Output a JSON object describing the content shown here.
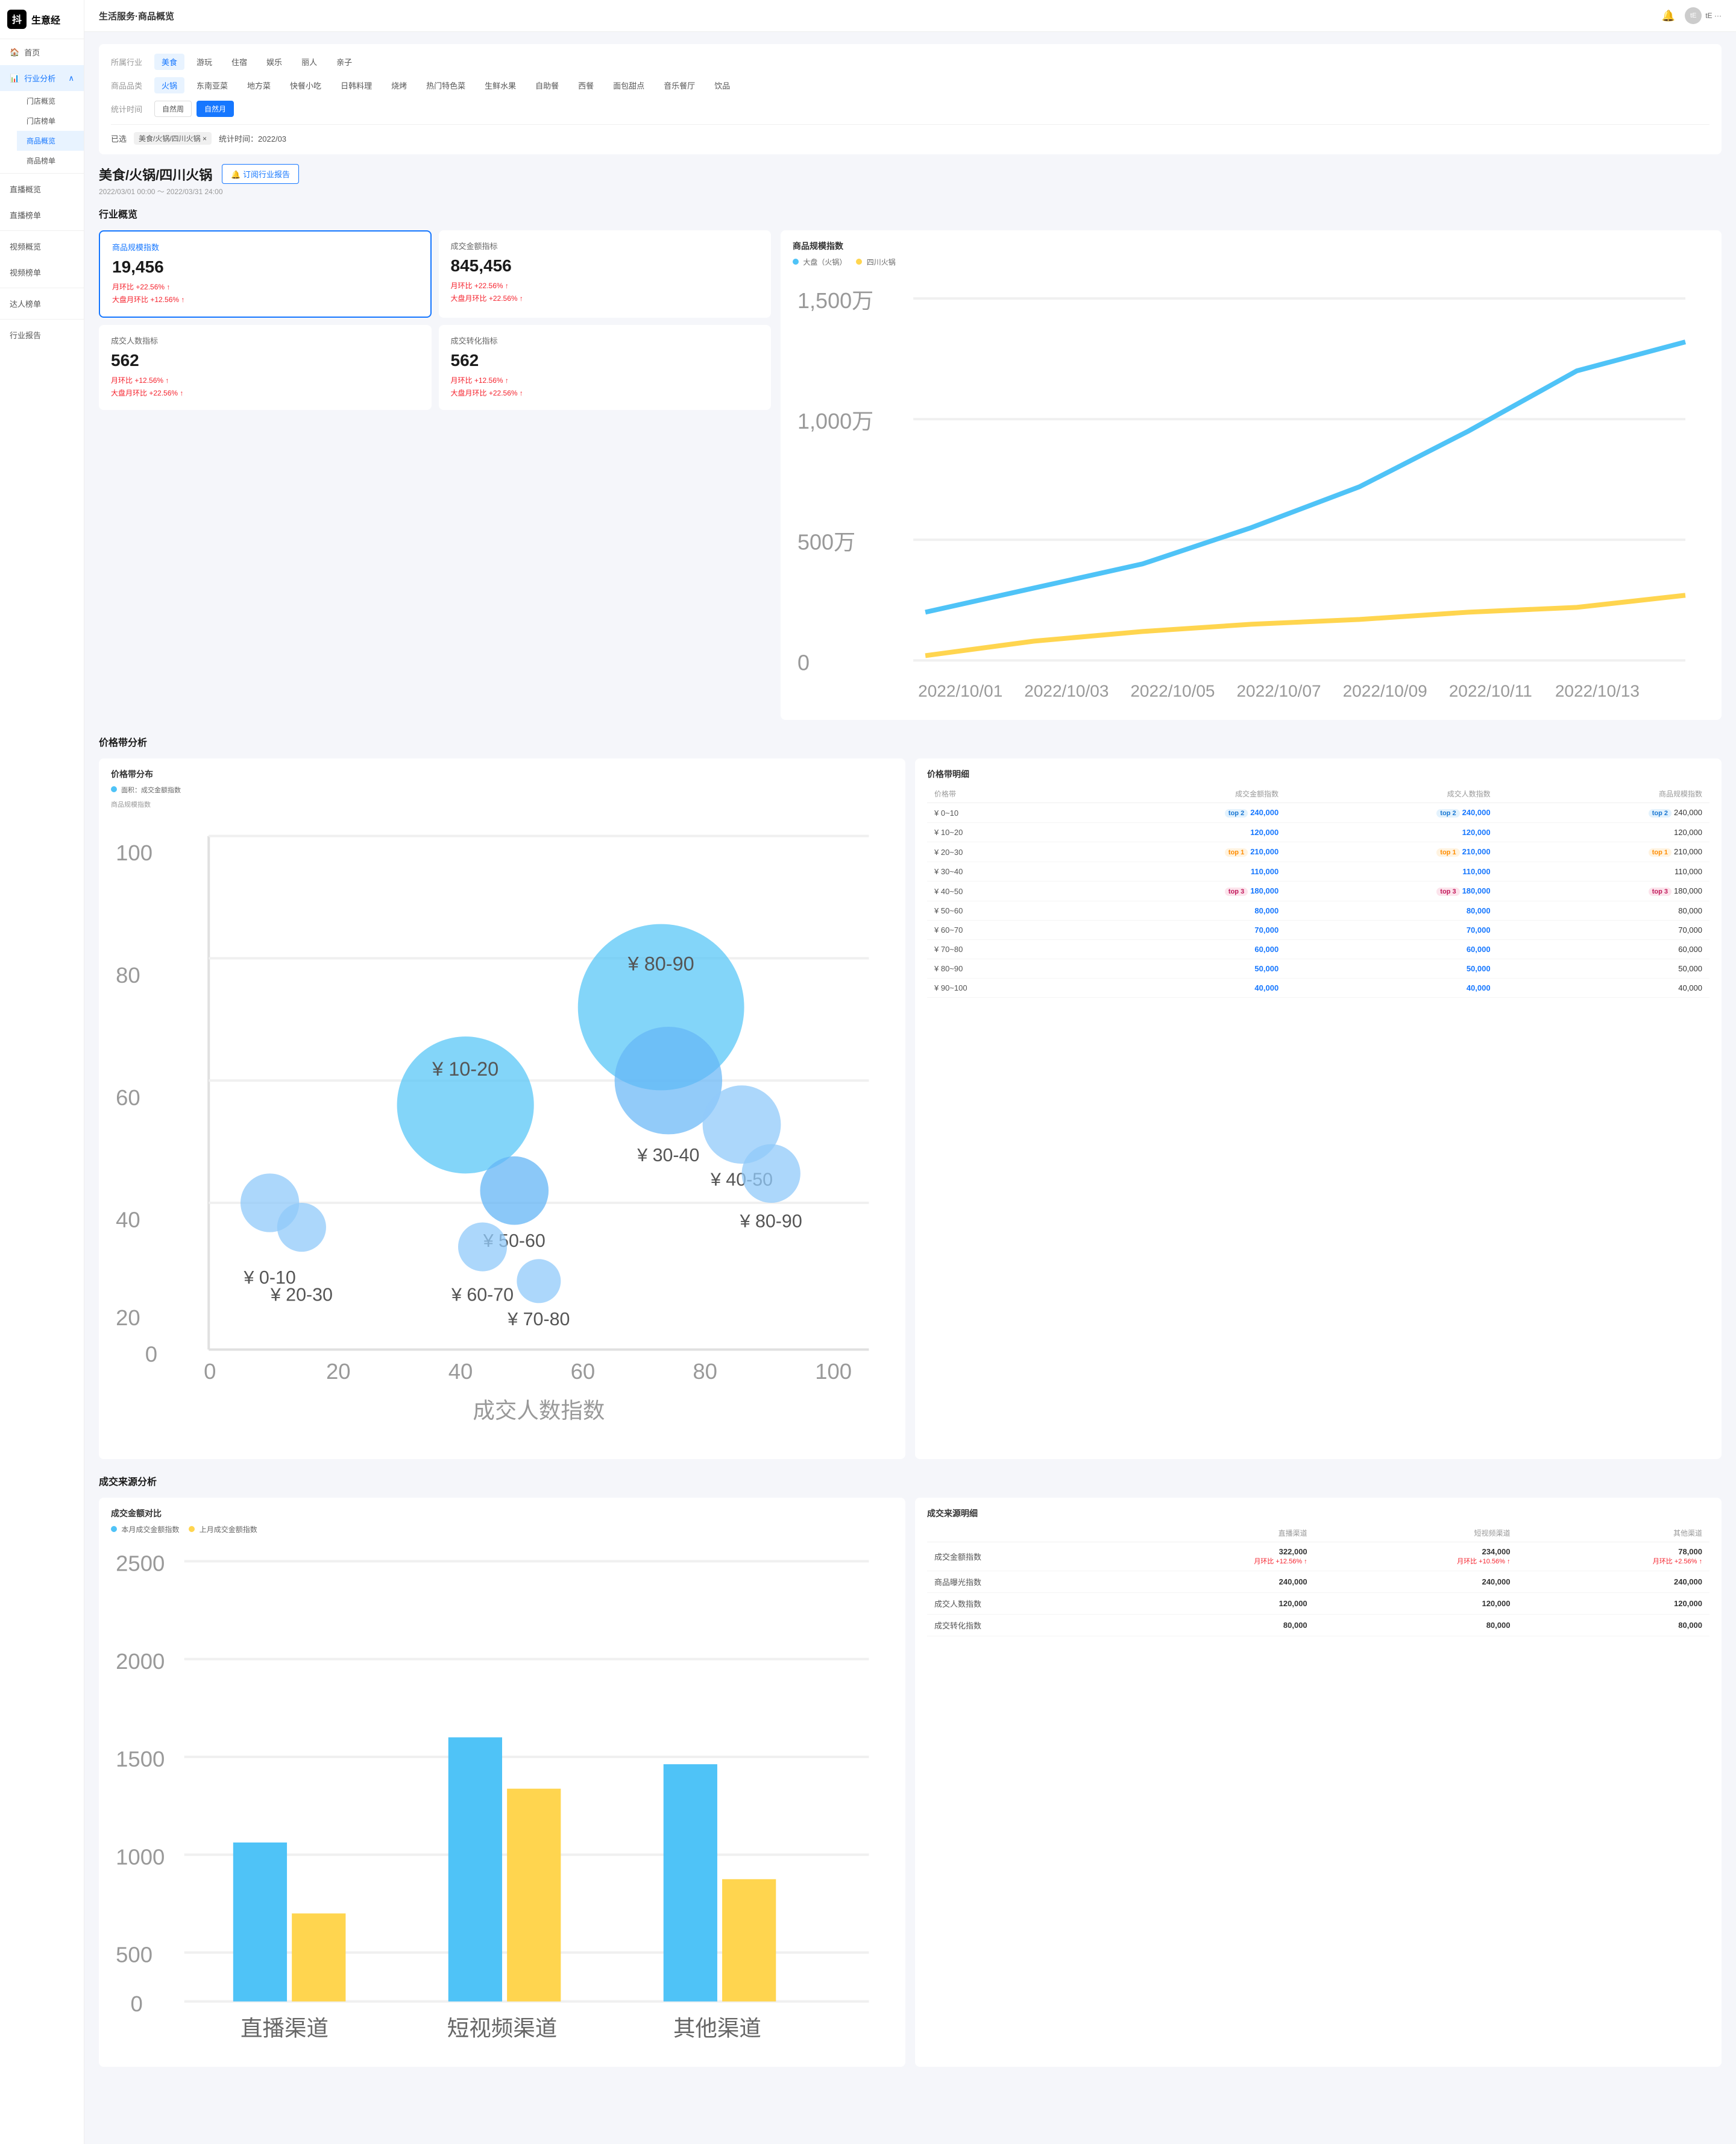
{
  "app": {
    "logo_text": "生意经",
    "topbar_title": "生活服务·商品概览",
    "bell_label": "🔔",
    "user_label": "tE ···"
  },
  "sidebar": {
    "home": "首页",
    "industry": "行业分析",
    "store_overview": "门店概览",
    "store_rank": "门店榜单",
    "product_overview": "商品概览",
    "product_rank": "商品榜单",
    "live_overview": "直播概览",
    "live_rank": "直播榜单",
    "video_overview": "视频概览",
    "video_rank": "视频榜单",
    "kol_rank": "达人榜单",
    "report": "行业报告"
  },
  "filters": {
    "industry_label": "所属行业",
    "product_label": "商品品类",
    "time_label": "统计时间",
    "industry_tags": [
      "美食",
      "游玩",
      "住宿",
      "娱乐",
      "丽人",
      "亲子"
    ],
    "product_tags": [
      "火锅",
      "东南亚菜",
      "地方菜",
      "快餐小吃",
      "日韩料理",
      "烧烤",
      "热门特色菜",
      "生鲜水果",
      "自助餐",
      "西餐",
      "面包甜点",
      "音乐餐厅",
      "饮品"
    ],
    "time_tags": [
      "自然周",
      "自然月"
    ],
    "active_industry": "美食",
    "active_product": "火锅",
    "active_time": "自然月",
    "selected": "美食/火锅/四川火锅 ×",
    "stat_time": "统计时间：2022/03"
  },
  "page": {
    "title": "美食/火锅/四川火锅",
    "subscribe_btn": "🔔 订阅行业报告",
    "date_range": "2022/03/01 00:00 ～ 2022/03/31 24:00",
    "industry_overview_title": "行业概览"
  },
  "kpi": {
    "card1_label": "商品规模指数",
    "card1_value": "19,456",
    "card1_mom": "月环比 +22.56% ↑",
    "card1_plate": "大盘月环比 +12.56% ↑",
    "card2_label": "成交金额指标",
    "card2_value": "845,456",
    "card2_mom": "月环比 +22.56% ↑",
    "card2_plate": "大盘月环比 +22.56% ↑",
    "card3_label": "成交人数指标",
    "card3_value": "562",
    "card3_mom": "月环比 +12.56% ↑",
    "card3_plate": "大盘月环比 +22.56% ↑",
    "card4_label": "成交转化指标",
    "card4_value": "562",
    "card4_mom": "月环比 +12.56% ↑",
    "card4_plate": "大盘月环比 +22.56% ↑"
  },
  "scale_chart": {
    "title": "商品规模指数",
    "legend1": "大盘（火锅）",
    "legend2": "四川火锅",
    "color1": "#4fc3f7",
    "color2": "#ffd54f",
    "x_labels": [
      "2022/10/01",
      "2022/10/03",
      "2022/10/05",
      "2022/10/07",
      "2022/10/09",
      "2022/10/11",
      "2022/10/13"
    ],
    "y_labels": [
      "1,500万",
      "1,000万",
      "500万",
      "0"
    ],
    "line1_points": "20,130 60,115 100,108 140,100 180,90 220,70 260,40",
    "line2_points": "20,155 60,148 100,145 140,140 180,138 220,135 260,130"
  },
  "price_section": {
    "title": "价格带分析",
    "chart_title": "价格带分布",
    "legend": "面积：成交金额指数",
    "y_axis_label": "商品规模指数",
    "x_axis_label": "成交人数指数",
    "table_title": "价格带明细",
    "table_headers": [
      "价格带",
      "成交金额指数",
      "成交人数指数",
      "商品规模指数"
    ],
    "table_rows": [
      {
        "range": "¥ 0~10",
        "badge_col1": "top 2",
        "val1": "240,000",
        "badge_col2": "top 2",
        "val2": "240,000",
        "badge_col3": "top 2",
        "val3": "240,000"
      },
      {
        "range": "¥ 10~20",
        "badge_col1": "",
        "val1": "120,000",
        "badge_col2": "",
        "val2": "120,000",
        "badge_col3": "",
        "val3": "120,000"
      },
      {
        "range": "¥ 20~30",
        "badge_col1": "top 1",
        "val1": "210,000",
        "badge_col2": "top 1",
        "val2": "210,000",
        "badge_col3": "top 1",
        "val3": "210,000"
      },
      {
        "range": "¥ 30~40",
        "badge_col1": "",
        "val1": "110,000",
        "badge_col2": "",
        "val2": "110,000",
        "badge_col3": "",
        "val3": "110,000"
      },
      {
        "range": "¥ 40~50",
        "badge_col1": "top 3",
        "val1": "180,000",
        "badge_col2": "top 3",
        "val2": "180,000",
        "badge_col3": "top 3",
        "val3": "180,000"
      },
      {
        "range": "¥ 50~60",
        "badge_col1": "",
        "val1": "80,000",
        "badge_col2": "",
        "val2": "80,000",
        "badge_col3": "",
        "val3": "80,000"
      },
      {
        "range": "¥ 60~70",
        "badge_col1": "",
        "val1": "70,000",
        "badge_col2": "",
        "val2": "70,000",
        "badge_col3": "",
        "val3": "70,000"
      },
      {
        "range": "¥ 70~80",
        "badge_col1": "",
        "val1": "60,000",
        "badge_col2": "",
        "val2": "60,000",
        "badge_col3": "",
        "val3": "60,000"
      },
      {
        "range": "¥ 80~90",
        "badge_col1": "",
        "val1": "50,000",
        "badge_col2": "",
        "val2": "50,000",
        "badge_col3": "",
        "val3": "50,000"
      },
      {
        "range": "¥ 90~100",
        "badge_col1": "",
        "val1": "40,000",
        "badge_col2": "",
        "val2": "40,000",
        "badge_col3": "",
        "val3": "40,000"
      }
    ]
  },
  "source_section": {
    "title": "成交来源分析",
    "chart_title": "成交金额对比",
    "legend1": "本月成交金额指数",
    "legend2": "上月成交金额指数",
    "color1": "#4fc3f7",
    "color2": "#ffd54f",
    "bar_labels": [
      "直播渠道",
      "短视频渠道",
      "其他渠道"
    ],
    "bar_this": [
      900,
      1500,
      1350
    ],
    "bar_last": [
      500,
      1200,
      700
    ],
    "y_ticks": [
      "2500",
      "2000",
      "1500",
      "1000",
      "500",
      "0"
    ],
    "table_title": "成交来源明细",
    "table_col1": "直播渠道",
    "table_col2": "短视频渠道",
    "table_col3": "其他渠道",
    "table_rows": [
      {
        "metric": "成交金额指数",
        "c1": "322,000",
        "c1_badge": "月环比 +12.56% ↑",
        "c2": "234,000",
        "c2_badge": "月环比 +10.56% ↑",
        "c3": "78,000",
        "c3_badge": "月环比 +2.56% ↑"
      },
      {
        "metric": "商品曝光指数",
        "c1": "240,000",
        "c1_badge": "",
        "c2": "240,000",
        "c2_badge": "",
        "c3": "240,000",
        "c3_badge": ""
      },
      {
        "metric": "成交人数指数",
        "c1": "120,000",
        "c1_badge": "",
        "c2": "120,000",
        "c2_badge": "",
        "c3": "120,000",
        "c3_badge": ""
      },
      {
        "metric": "成交转化指数",
        "c1": "80,000",
        "c1_badge": "",
        "c2": "80,000",
        "c2_badge": "",
        "c3": "80,000",
        "c3_badge": ""
      }
    ]
  },
  "bubbles": [
    {
      "label": "¥ 0-10",
      "x": 8,
      "y": 40,
      "r": 12,
      "color": "#90caf9"
    },
    {
      "label": "¥ 20-30",
      "x": 12,
      "y": 38,
      "r": 12,
      "color": "#90caf9"
    },
    {
      "label": "¥ 10-20",
      "x": 38,
      "y": 63,
      "r": 28,
      "color": "#4fc3f7"
    },
    {
      "label": "¥ 60-70",
      "x": 40,
      "y": 30,
      "r": 10,
      "color": "#90caf9"
    },
    {
      "label": "¥ 50-60",
      "x": 47,
      "y": 44,
      "r": 14,
      "color": "#90caf9"
    },
    {
      "label": "¥ 70-80",
      "x": 50,
      "y": 24,
      "r": 9,
      "color": "#90caf9"
    },
    {
      "label": "¥ 80-90",
      "x": 65,
      "y": 71,
      "r": 32,
      "color": "#4fc3f7"
    },
    {
      "label": "¥ 30-40",
      "x": 68,
      "y": 62,
      "r": 24,
      "color": "#64b5f6"
    },
    {
      "label": "¥ 40-50",
      "x": 80,
      "y": 56,
      "r": 16,
      "color": "#90caf9"
    },
    {
      "label": "¥ 80-90",
      "x": 83,
      "y": 50,
      "r": 12,
      "color": "#90caf9"
    }
  ]
}
